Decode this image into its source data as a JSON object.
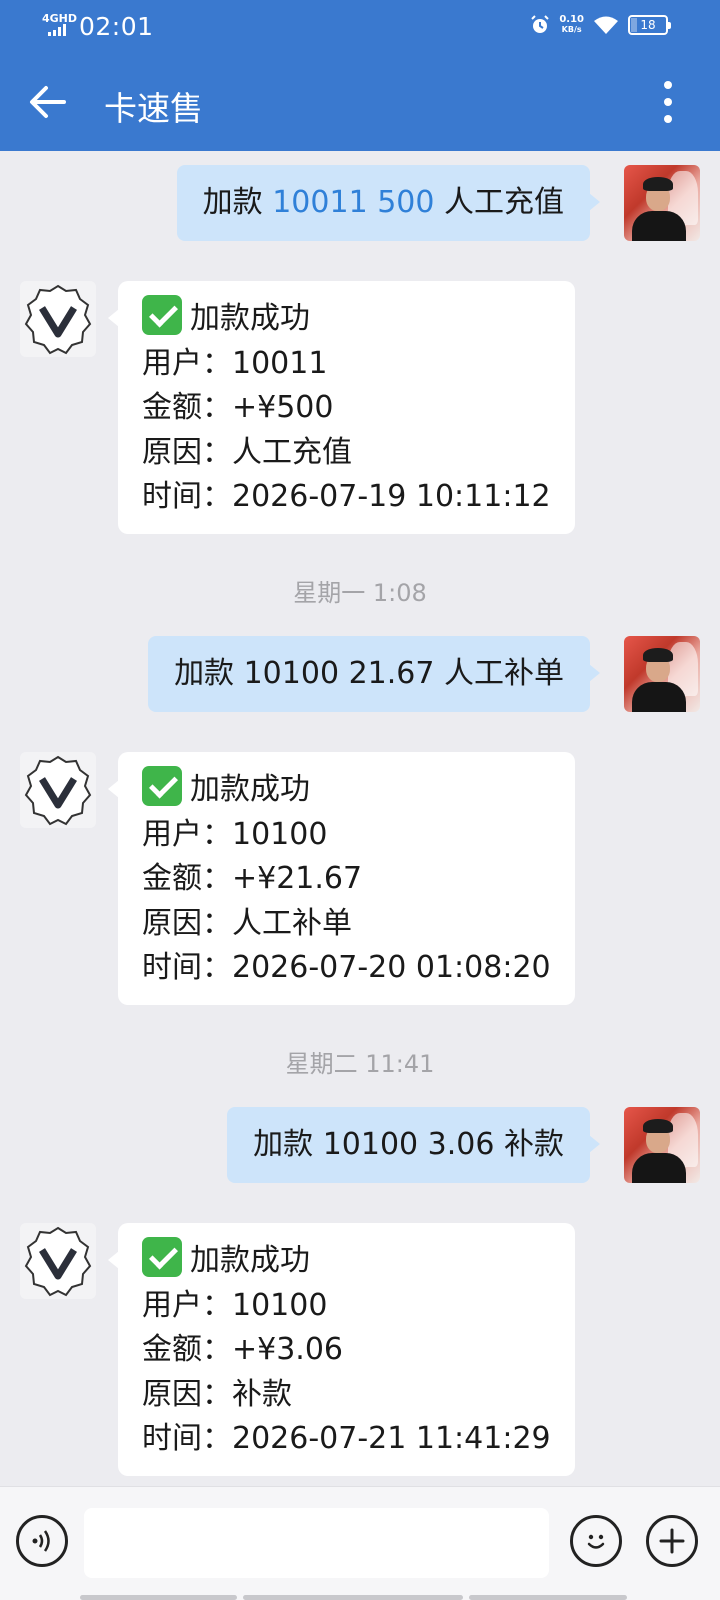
{
  "status_bar": {
    "network": "4GHD",
    "time": "02:01",
    "speed_value": "0.10",
    "speed_unit": "KB/s",
    "battery": "18",
    "battery_level": 0.18
  },
  "header": {
    "title": "卡速售"
  },
  "messages": [
    {
      "out_prefix": "加款 ",
      "out_highlight": "10011 500",
      "out_suffix": " 人工充值",
      "reply": {
        "status": "加款成功",
        "user": "用户：10011",
        "amount": "金额：+¥500",
        "reason": "原因：人工充值",
        "time": "时间：2026-07-19 10:11:12"
      }
    },
    {
      "timestamp": "星期一 1:08",
      "out_text": "加款 10100 21.67 人工补单",
      "reply": {
        "status": "加款成功",
        "user": "用户：10100",
        "amount": "金额：+¥21.67",
        "reason": "原因：人工补单",
        "time": "时间：2026-07-20 01:08:20"
      }
    },
    {
      "timestamp": "星期二 11:41",
      "out_text": "加款 10100 3.06 补款",
      "reply": {
        "status": "加款成功",
        "user": "用户：10100",
        "amount": "金额：+¥3.06",
        "reason": "原因：补款",
        "time": "时间：2026-07-21 11:41:29"
      }
    }
  ],
  "input": {
    "placeholder": ""
  },
  "colors": {
    "header": "#3a79cf",
    "out_bubble": "#cde4fa",
    "highlight": "#2f80d8",
    "success_check": "#3fb54a",
    "background": "#ececf0"
  },
  "icons": [
    "back-arrow-icon",
    "more-vertical-icon",
    "voice-icon",
    "emoji-icon",
    "plus-icon",
    "check-icon",
    "alarm-icon",
    "wifi-icon",
    "battery-icon",
    "signal-icon"
  ]
}
